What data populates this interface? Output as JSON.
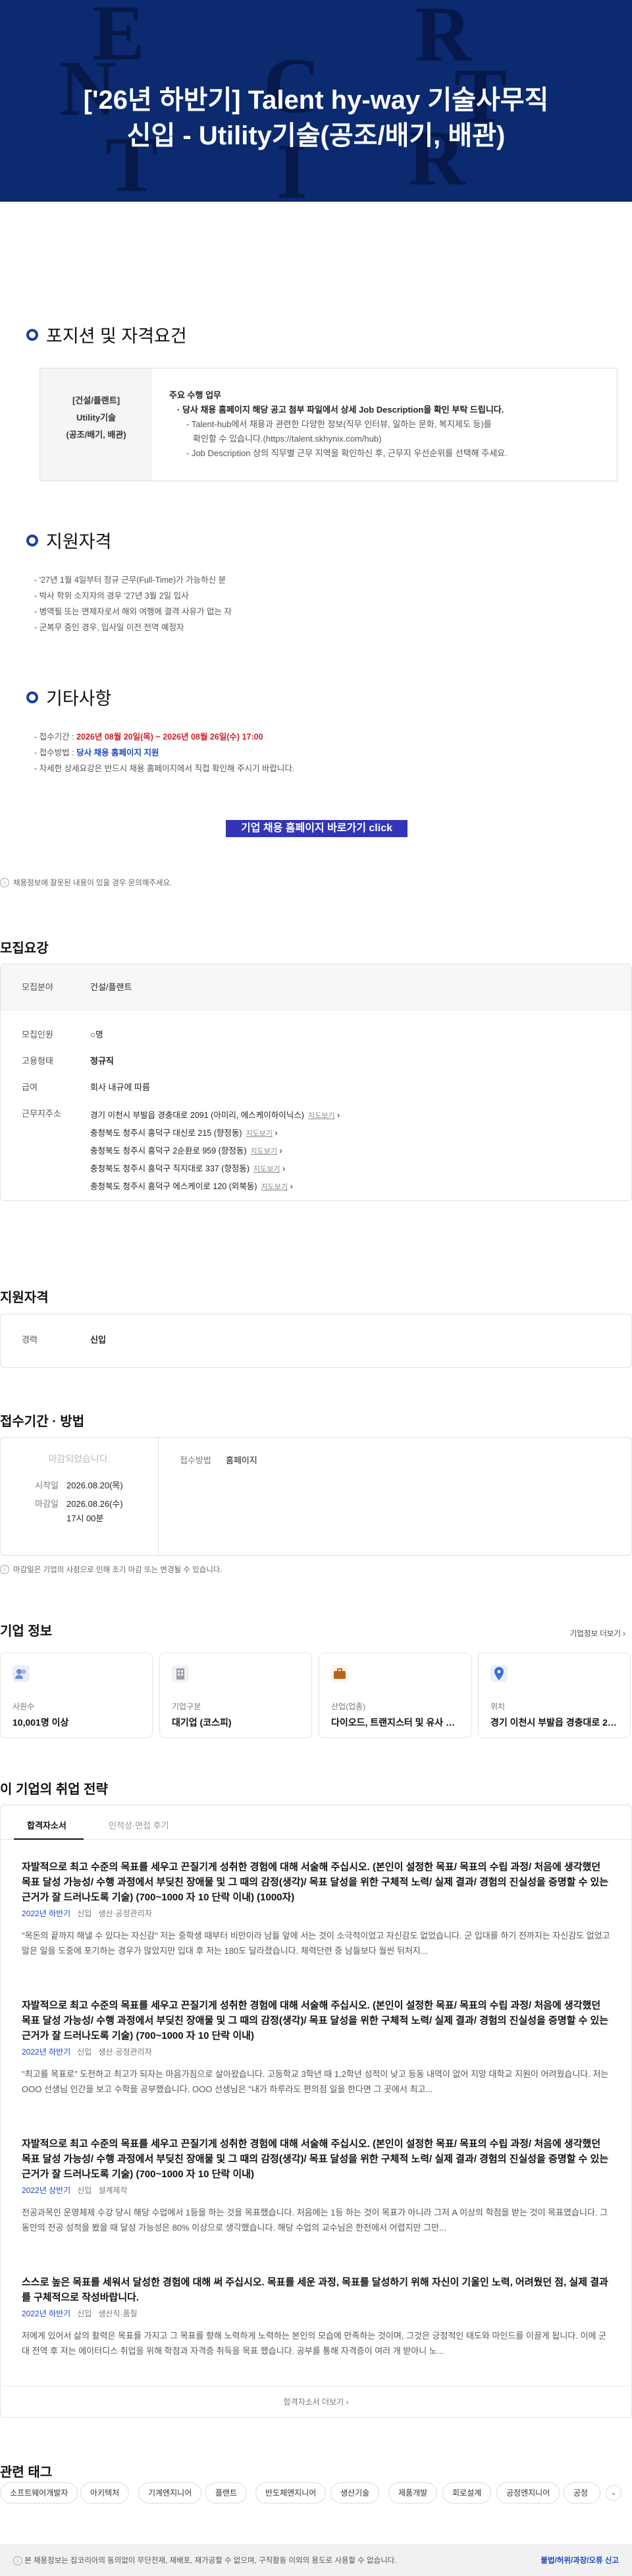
{
  "hero": {
    "title_line1": "['26년 하반기] Talent hy-way 기술사무직",
    "title_line2": "신입 - Utility기술(공조/배기, 배관)"
  },
  "poster": {
    "position_title": "포지션 및 자격요건",
    "pos_left": [
      "[건설/플랜트]",
      "Utility기술",
      "(공조/배기, 배관)"
    ],
    "duty_head": "주요 수행 업무",
    "duty_bold": "· 당사 채용 홈페이지 해당 공고 첨부 파일에서 상세 Job Description을 확인 부탁 드립니다.",
    "duty_sub1": "- Talent-hub에서 채용과 관련한 다양한 정보(직무 인터뷰, 일하는 문화, 복지제도 등)를",
    "duty_sub1b": "확인할 수 있습니다.(https://talent.skhynix.com/hub)",
    "duty_sub2": "- Job Description 상의 직무별 근무 지역을 확인하신 후, 근무지 우선순위를 선택해 주세요.",
    "qual_title": "지원자격",
    "qual": [
      "- '27년 1월 4일부터 정규 근무(Full-Time)가 가능하신 분",
      "- 박사 학위 소지자의 경우 '27년 3월 2일 입사",
      "- 병역필 또는 면제자로서 해외 여행에 결격 사유가 없는 자",
      "- 군복무 중인 경우, 입사일 이전 전역 예정자"
    ],
    "etc_title": "기타사항",
    "etc_period_label": "- 접수기간 : ",
    "etc_period": "2026년 08월 20일(목) ~ 2026년 08월 26일(수) 17:00",
    "etc_method_label": "- 접수방법 : ",
    "etc_method": "당사 채용 홈페이지 지원",
    "etc_more": "- 자세한 상세요강은 반드시 채용 홈페이지에서 직접 확인해 주시기 바랍니다.",
    "cta": "기업 채용 홈페이지 바로가기 click"
  },
  "note_top": "채용정보에 잘못된 내용이 있을 경우 문의해주세요.",
  "recruit": {
    "title": "모집요강",
    "field_label": "모집분야",
    "field": "건설/플랜트",
    "count_label": "모집인원",
    "count": "○명",
    "type_label": "고용형태",
    "type": "정규직",
    "pay_label": "급여",
    "pay": "회사 내규에 따름",
    "addr_label": "근무지주소",
    "addrs": [
      "경기 이천시 부발읍 경충대로 2091 (아미리, 에스케이하이닉스)",
      "충청북도 청주시 흥덕구 대신로 215 (향정동)",
      "충청북도 청주시 흥덕구 2순환로 959 (향정동)",
      "충청북도 청주시 흥덕구 직지대로 337 (향정동)",
      "충청북도 청주시 흥덕구 에스케이로 120 (외북동)"
    ],
    "map": "지도보기"
  },
  "qualify": {
    "title": "지원자격",
    "career_label": "경력",
    "career": "신입"
  },
  "apply": {
    "title": "접수기간 · 방법",
    "closed": "마감되었습니다.",
    "start_label": "시작일",
    "start": "2026.08.20(목)",
    "end_label": "마감일",
    "end": "2026.08.26(수)",
    "end_time": "17시 00분",
    "method_label": "접수방법",
    "method": "홈페이지",
    "note": "마감일은 기업의 사정으로 인해 조기 마감 또는 변경될 수 있습니다."
  },
  "company": {
    "title": "기업 정보",
    "more": "기업정보 더보기",
    "cards": [
      {
        "label": "사원수",
        "value": "10,001명 이상",
        "icon": "people-icon"
      },
      {
        "label": "기업구분",
        "value": "대기업 (코스피)",
        "icon": "building-icon"
      },
      {
        "label": "산업(업종)",
        "value": "다이오드, 트랜지스터 및 유사 반...",
        "icon": "briefcase-icon"
      },
      {
        "label": "위치",
        "value": "경기 이천시 부발읍 경충대로 20...",
        "icon": "location-pin-icon"
      }
    ]
  },
  "strategy": {
    "title": "이 기업의 취업 전략",
    "tab1": "합격자소서",
    "tab2": "인적성·면접 후기",
    "items": [
      {
        "q": "자발적으로 최고 수준의 목표를 세우고 끈질기게 성취한 경험에 대해 서술해 주십시오. (본인이 설정한 목표/ 목표의 수립 과정/ 처음에 생각했던 목표 달성 가능성/ 수행 과정에서 부딪친 장애물 및 그 때의 감정(생각)/ 목표 달성을 위한 구체적 노력/ 실제 결과/ 경험의 진실성을 증명할 수 있는 근거가 잘 드러나도록 기술) (700~1000 자 10 단락 이내) (1000자)",
        "year": "2022년 하반기",
        "lvl": "신입",
        "job": "생산·공정관리자",
        "a": "\"목돈의 끝까지 해낼 수 있다는 자신감\" 저는 중학생 때부터 비만이라 남들 앞에 서는 것이 소극적이었고 자신감도 없었습니다. 군 입대를 하기 전까지는 자신감도 없었고 말은 일을 도중에 포기하는 경우가 많았지만 입대 후 저는 180도 달라졌습니다. 체력단련 중 남들보다 월씬 뒤처지..."
      },
      {
        "q": "자발적으로 최고 수준의 목표를 세우고 끈질기게 성취한 경험에 대해 서술해 주십시오. (본인이 설정한 목표/ 목표의 수립 과정/ 처음에 생각했던 목표 달성 가능성/ 수행 과정에서 부딪친 장애물 및 그 때의 감정(생각)/ 목표 달성을 위한 구체적 노력/ 실제 결과/ 경험의 진실성을 증명할 수 있는 근거가 잘 드러나도록 기술) (700~1000 자 10 단락 이내)",
        "year": "2022년 하반기",
        "lvl": "신입",
        "job": "생산·공정관리자",
        "a": "\"최고를 목표로\" 도전하고 최고가 되자는 마음가짐으로 살아왔습니다. 고등학교 3학년 때 1,2학년 성적이 낮고 등동 내역이 없어 지망 대학교 지원이 어려웠습니다. 저는 OOO 선생님 인간을 보고 수학을 공부했습니다. OOO 선생님은 \"내가 하루라도 편의점 일을 한다면 그 곳에서 최고..."
      },
      {
        "q": "자발적으로 최고 수준의 목표를 세우고 끈질기게 성취한 경험에 대해 서술해 주십시오. (본인이 설정한 목표/ 목표의 수립 과정/ 처음에 생각했던 목표 달성 가능성/ 수행 과정에서 부딪친 장애물 및 그 때의 감정(생각)/ 목표 달성을 위한 구체적 노력/ 실제 결과/ 경험의 진실성을 증명할 수 있는 근거가 잘 드러나도록 기술) (700~1000 자 10 단락 이내)",
        "year": "2022년 상반기",
        "lvl": "신입",
        "job": "설계제작",
        "a": "전공과목인 운영체제 수강 당시 해당 수업에서 1등을 하는 것을 목표했습니다. 처음에는 1등 하는 것이 목표가 아니라 그저 A 이상의 학점을 받는 것이 목표였습니다. 그동안의 전공 성적을 봤을 때 달성 가능성은 80% 이상으로 생각했습니다. 해당 수업의 교수님은 한전에서 어렵지만 그만..."
      },
      {
        "q": "스스로 높은 목표를 세워서 달성한 경험에 대해 써 주십시오. 목표를 세운 과정, 목표를 달성하기 위해 자신이 기울인 노력, 어려웠던 점, 실제 결과를 구체적으로 작성바랍니다.",
        "year": "2022년 하반기",
        "lvl": "신입",
        "job": "생산직·품질",
        "a": "저에게 있어서 삶의 활력은 목표를 가지고 그 목표를 향해 노력하게 노력하는 본인의 모습에 만족하는 것이며, 그것은 긍정적인 태도와 마인드를 이끌게 됩니다. 이에 군대 전역 후 저는 에이터디스 취업을 위해 학점과 자격증 취득을 목표 했습니다. 공부를 통해 자격증이 여러 개 받아니 노..."
      }
    ],
    "more": "합격자소서 더보기"
  },
  "tags": {
    "title": "관련 태그",
    "items": [
      "소프트웨어개발자",
      "아키텍처",
      "기계엔지니어",
      "플랜트",
      "반도체엔지니어",
      "생산기술",
      "제품개발",
      "회로설계",
      "공정엔지니어",
      "공정"
    ]
  },
  "footer": {
    "left": "본 채용정보는 잡코리아의 동의없이 무단전재, 재배포, 재가공할 수 없으며, 구직활동 이외의 용도로 사용할 수 없습니다.",
    "right": "불법/허위/과장/오류 신고"
  }
}
